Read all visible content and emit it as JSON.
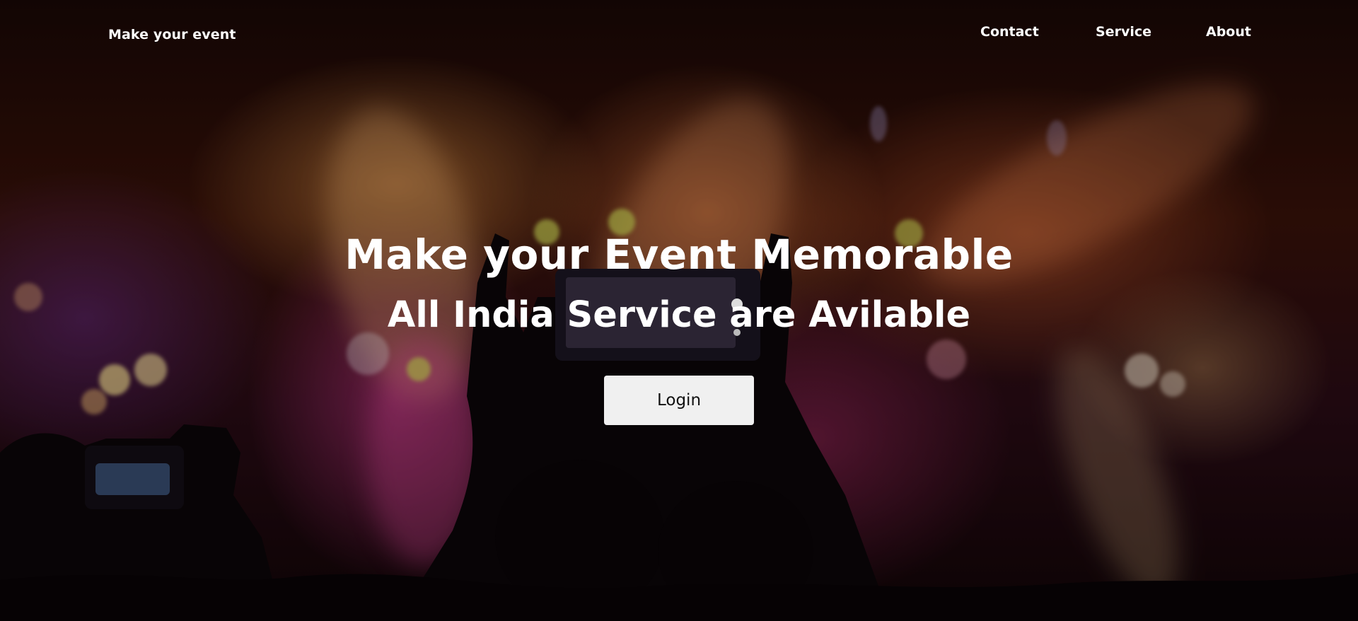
{
  "navbar": {
    "brand": "Make your event",
    "links": [
      "Contact",
      "Service",
      "About"
    ]
  },
  "hero": {
    "title": "Make your Event Memorable",
    "subtitle": "All India Service are Avilable",
    "login_label": "Login"
  },
  "colors": {
    "text": "#ffffff",
    "button_bg": "#f0f0f0",
    "button_text": "#111111"
  },
  "background": {
    "image": "concert-crowd-photo"
  }
}
